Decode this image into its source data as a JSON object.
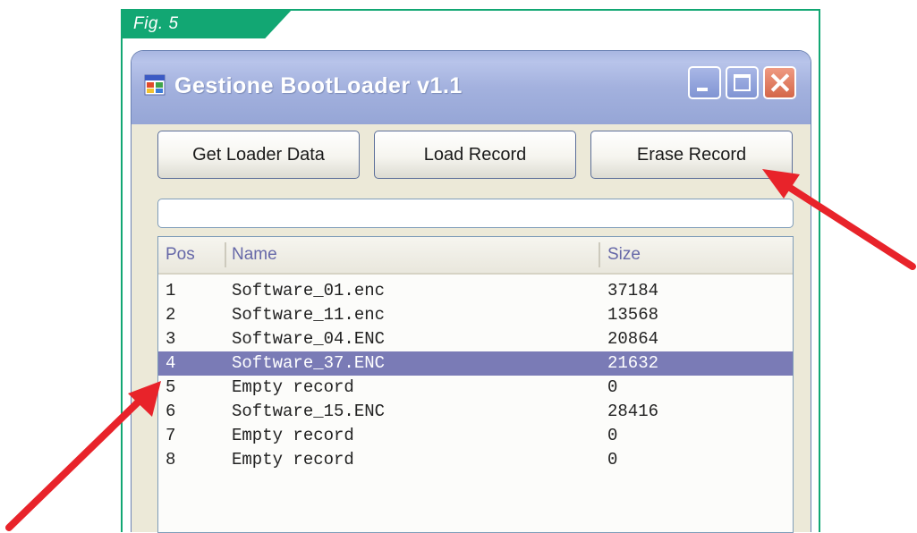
{
  "figure": {
    "label": "Fig. 5"
  },
  "window": {
    "title": "Gestione BootLoader v1.1"
  },
  "buttons": {
    "get_loader_data": "Get Loader Data",
    "load_record": "Load Record",
    "erase_record": "Erase Record"
  },
  "textbox": {
    "value": ""
  },
  "table": {
    "columns": [
      "Pos",
      "Name",
      "Size"
    ],
    "rows": [
      {
        "pos": "1",
        "name": "Software_01.enc",
        "size": "37184"
      },
      {
        "pos": "2",
        "name": "Software_11.enc",
        "size": "13568"
      },
      {
        "pos": "3",
        "name": "Software_04.ENC",
        "size": "20864"
      },
      {
        "pos": "4",
        "name": "Software_37.ENC",
        "size": "21632"
      },
      {
        "pos": "5",
        "name": "Empty record",
        "size": "0"
      },
      {
        "pos": "6",
        "name": "Software_15.ENC",
        "size": "28416"
      },
      {
        "pos": "7",
        "name": "Empty record",
        "size": "0"
      },
      {
        "pos": "8",
        "name": "Empty record",
        "size": "0"
      }
    ],
    "selected_row": 3
  },
  "colors": {
    "figure_accent": "#12a773",
    "selection": "#7a7bb6",
    "arrow": "#e8232a"
  },
  "icons": {
    "app": "app-window-icon",
    "minimize": "minimize-icon",
    "maximize": "maximize-icon",
    "close": "close-icon"
  }
}
